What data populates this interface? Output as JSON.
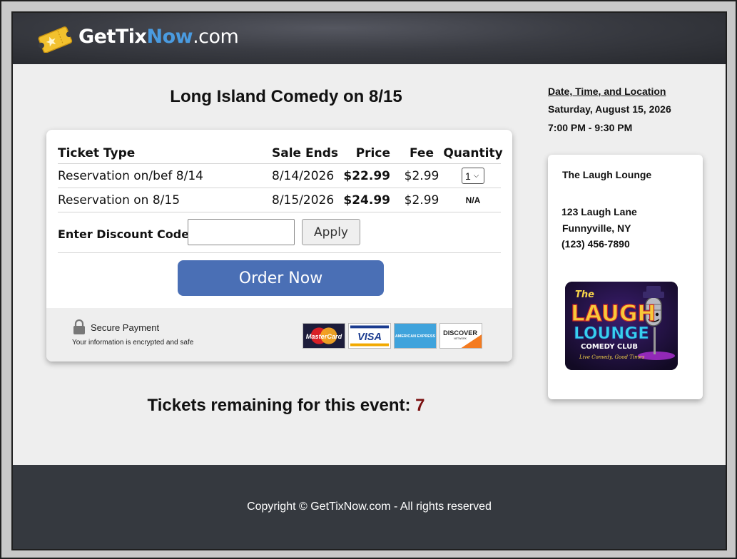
{
  "brand": {
    "part1": "GetTix",
    "part2": "Now",
    "part3": ".com",
    "accent_color": "#4a9be0"
  },
  "event": {
    "title": "Long Island Comedy on 8/15"
  },
  "table": {
    "headers": {
      "type": "Ticket Type",
      "sale_ends": "Sale Ends",
      "price": "Price",
      "fee": "Fee",
      "quantity": "Quantity"
    },
    "rows": [
      {
        "type": "Reservation on/bef 8/14",
        "sale_ends": "8/14/2026",
        "price": "$22.99",
        "fee": "$2.99",
        "quantity": "1"
      },
      {
        "type": "Reservation on 8/15",
        "sale_ends": "8/15/2026",
        "price": "$24.99",
        "fee": "$2.99",
        "quantity": "N/A"
      }
    ]
  },
  "discount": {
    "label": "Enter Discount Code:",
    "value": "",
    "apply_label": "Apply"
  },
  "order": {
    "label": "Order Now",
    "color": "#4a6fb5"
  },
  "secure": {
    "title": "Secure Payment",
    "subtitle": "Your information is encrypted and safe",
    "cards": [
      {
        "name": "MasterCard",
        "icon": "mastercard-icon"
      },
      {
        "name": "VISA",
        "icon": "visa-icon"
      },
      {
        "name": "AMERICAN EXPRESS",
        "icon": "amex-icon"
      },
      {
        "name": "DISCOVER",
        "sub": "NETWORK",
        "icon": "discover-icon"
      }
    ]
  },
  "remaining": {
    "label": "Tickets remaining for this event:",
    "count": "7",
    "count_color": "#7a1010"
  },
  "sidebar": {
    "heading": "Date, Time, and Location",
    "date": "Saturday, August 15, 2026",
    "time": "7:00 PM - 9:30 PM"
  },
  "venue": {
    "name": "The Laugh Lounge",
    "street": "123 Laugh Lane",
    "city": "Funnyville, NY",
    "phone": "(123) 456-7890",
    "logo": {
      "line1": "The",
      "line2": "LAUGH",
      "line3": "LOUNGE",
      "line4": "COMEDY CLUB",
      "tagline": "Live Comedy, Good Times"
    }
  },
  "footer": {
    "copyright": "Copyright © GetTixNow.com - All rights reserved"
  }
}
